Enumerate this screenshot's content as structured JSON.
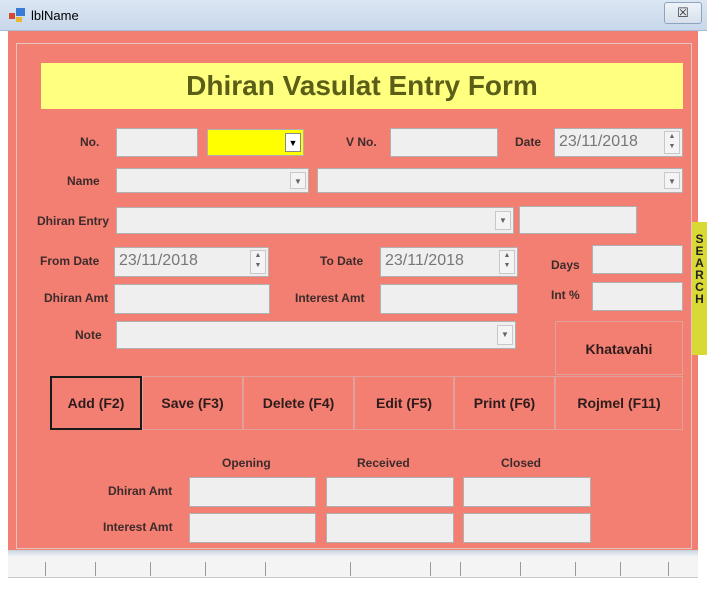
{
  "window": {
    "title": "lblName",
    "close_glyph": "☒"
  },
  "form": {
    "heading": "Dhiran Vasulat Entry Form",
    "labels": {
      "no": "No.",
      "vno": "V No.",
      "date": "Date",
      "name": "Name",
      "dhiran_entry": "Dhiran Entry",
      "from_date": "From Date",
      "to_date": "To Date",
      "days": "Days",
      "dhiran_amt": "Dhiran Amt",
      "interest_amt": "Interest Amt",
      "int_pct": "Int %",
      "note": "Note"
    },
    "values": {
      "date": "23/11/2018",
      "from_date": "23/11/2018",
      "to_date": "23/11/2018"
    },
    "khatavahi_label": "Khatavahi",
    "buttons": {
      "add": "Add (F2)",
      "save": "Save (F3)",
      "delete": "Delete (F4)",
      "edit": "Edit (F5)",
      "print": "Print (F6)",
      "rojmel": "Rojmel (F11)"
    },
    "summary": {
      "columns": {
        "opening": "Opening",
        "received": "Received",
        "closed": "Closed"
      },
      "rows": {
        "dhiran_amt": "Dhiran Amt",
        "interest_amt": "Interest Amt"
      }
    }
  },
  "search_strip": {
    "letters": [
      "S",
      "E",
      "A",
      "R",
      "C",
      "H"
    ]
  },
  "colors": {
    "form_bg": "#f27f71",
    "heading_bg": "#ffff80",
    "combo_highlight": "#ffff00",
    "search_strip": "#d9d936"
  }
}
